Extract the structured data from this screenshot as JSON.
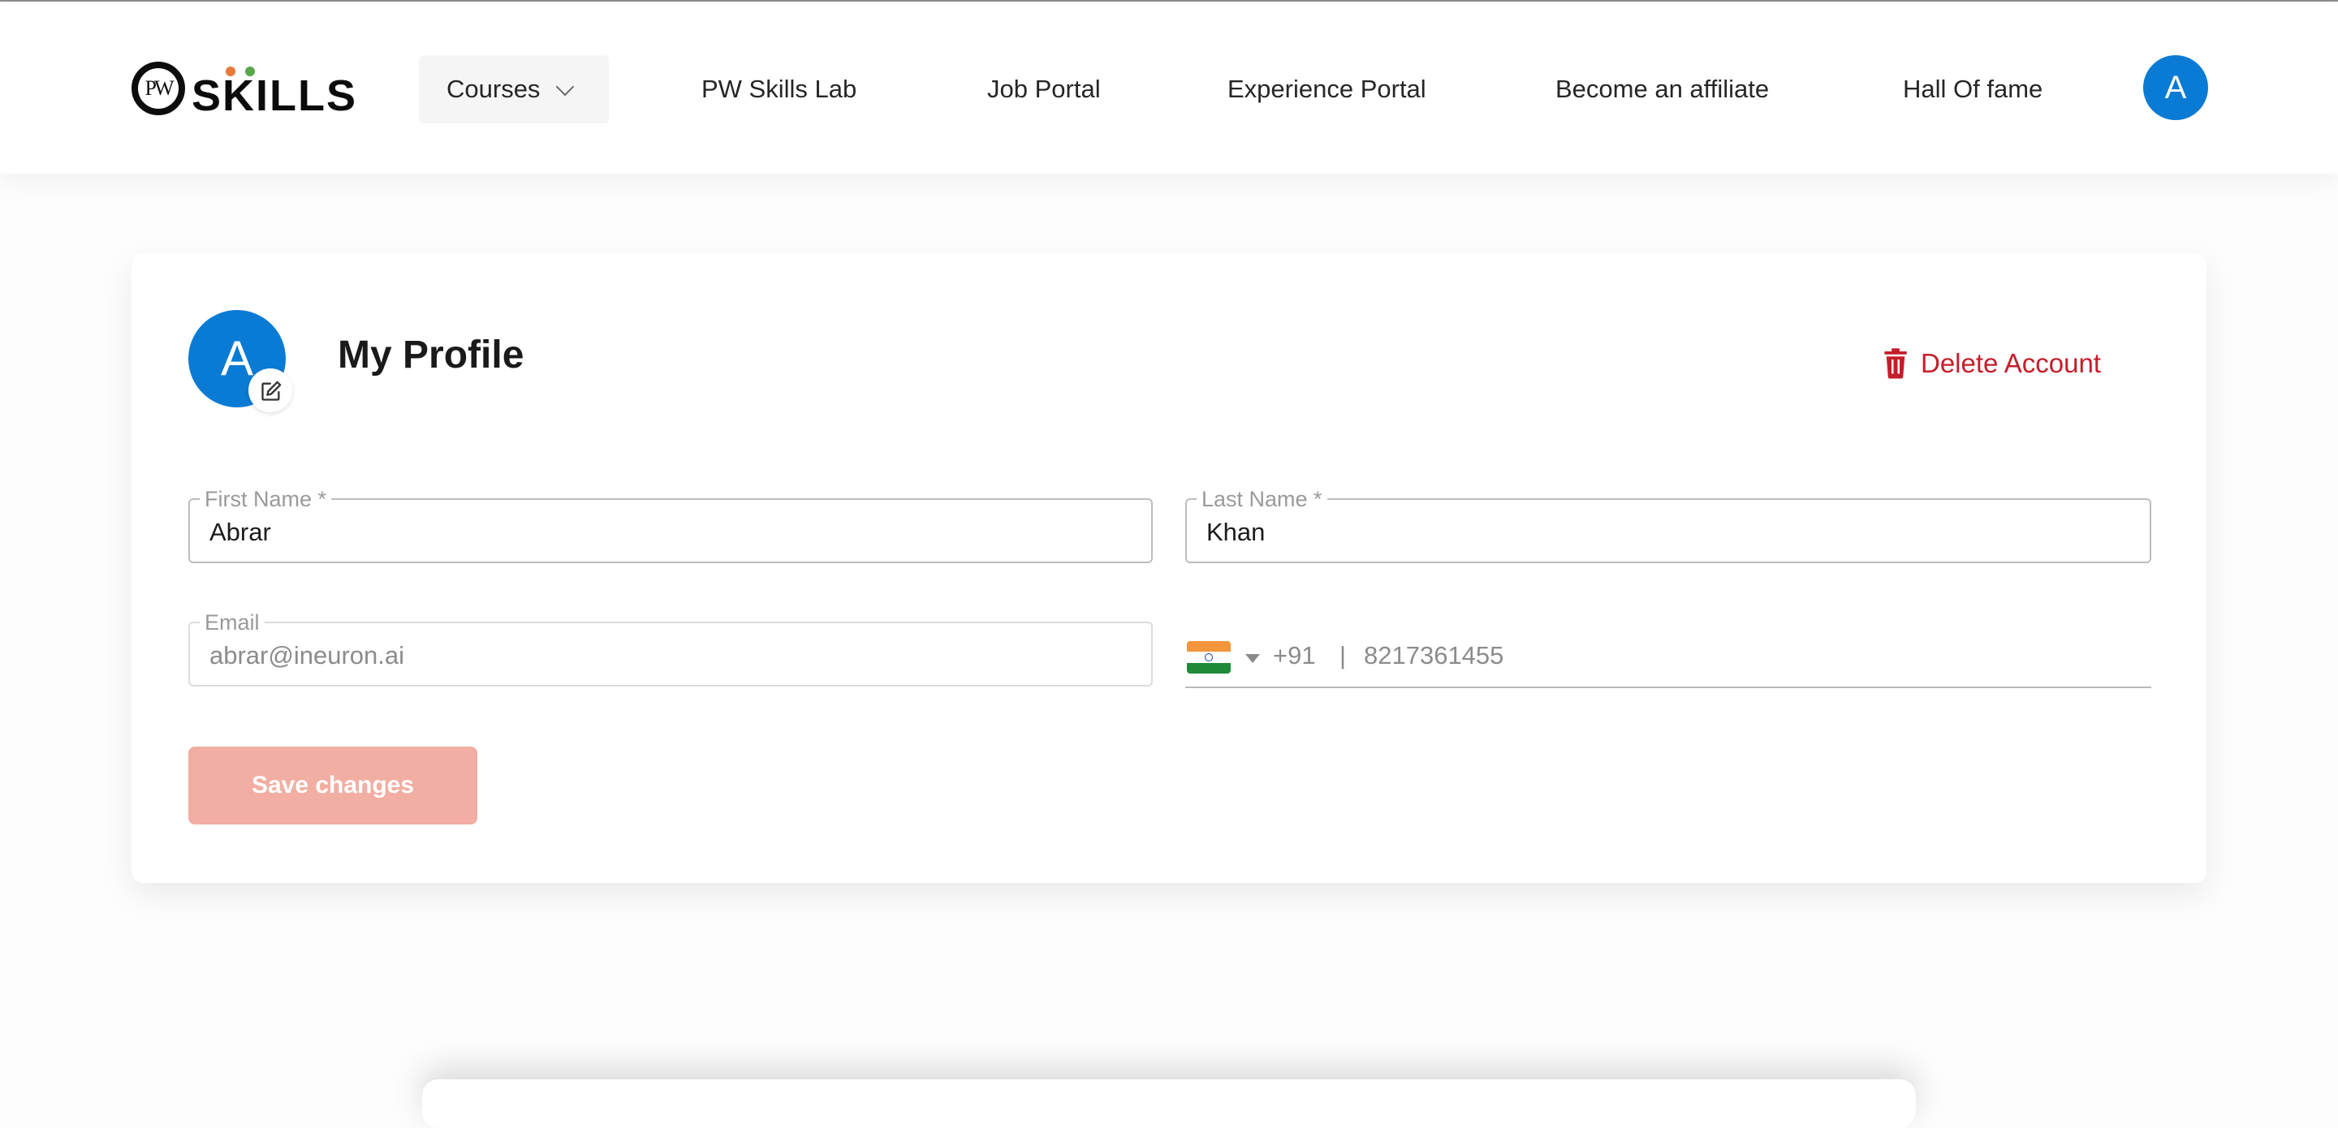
{
  "header": {
    "logo_text": "SKILLS",
    "logo_mark": "PW",
    "nav": [
      {
        "label": "Courses",
        "has_dropdown": true
      },
      {
        "label": "PW Skills Lab"
      },
      {
        "label": "Job Portal"
      },
      {
        "label": "Experience Portal"
      },
      {
        "label": "Become an affiliate"
      },
      {
        "label": "Hall Of fame"
      }
    ],
    "avatar_initial": "A",
    "avatar_color": "#0a7bd4"
  },
  "profile": {
    "avatar_initial": "A",
    "title": "My Profile",
    "delete_label": "Delete Account",
    "delete_color": "#c41e2a",
    "first_name": {
      "label": "First Name *",
      "value": "Abrar"
    },
    "last_name": {
      "label": "Last Name *",
      "value": "Khan"
    },
    "email": {
      "label": "Email",
      "value": "abrar@ineuron.ai"
    },
    "phone": {
      "flag_icon": "india-flag-icon",
      "country_code": "+91",
      "separator": "|",
      "number": "8217361455"
    },
    "save_label": "Save changes",
    "save_color": "#f2aea3"
  }
}
